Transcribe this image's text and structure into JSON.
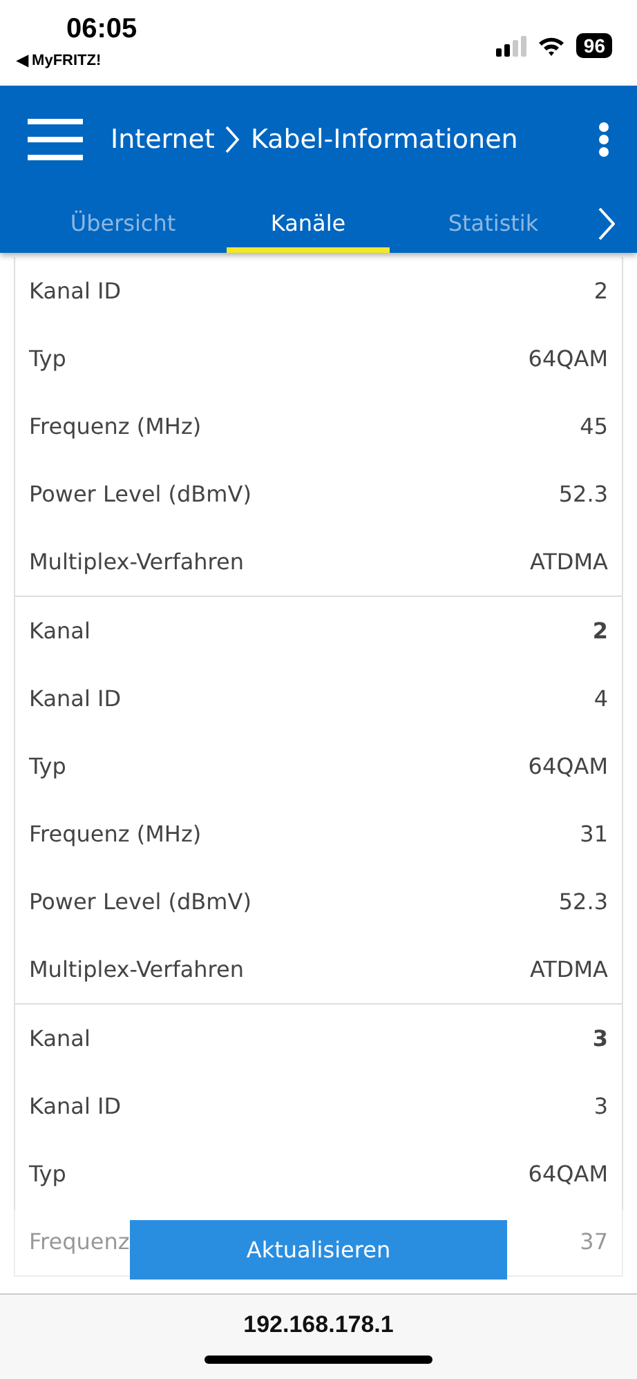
{
  "status_bar": {
    "time": "06:05",
    "back_app": "◀ MyFRITZ!",
    "battery": "96"
  },
  "header": {
    "title": "Internet",
    "subtitle": "Kabel-Informationen"
  },
  "tabs": [
    {
      "label": "Übersicht",
      "selected": false
    },
    {
      "label": "Kanäle",
      "selected": true
    },
    {
      "label": "Statistik",
      "selected": false
    }
  ],
  "groups": [
    {
      "rows": [
        {
          "kind": "field",
          "label": "Kanal ID",
          "value": "2"
        },
        {
          "kind": "field",
          "label": "Typ",
          "value": "64QAM"
        },
        {
          "kind": "field",
          "label": "Frequenz (MHz)",
          "value": "45"
        },
        {
          "kind": "field",
          "label": "Power Level (dBmV)",
          "value": "52.3"
        },
        {
          "kind": "field",
          "label": "Multiplex-Verfahren",
          "value": "ATDMA"
        }
      ]
    },
    {
      "rows": [
        {
          "kind": "header",
          "label": "Kanal",
          "value": "2"
        },
        {
          "kind": "field",
          "label": "Kanal ID",
          "value": "4"
        },
        {
          "kind": "field",
          "label": "Typ",
          "value": "64QAM"
        },
        {
          "kind": "field",
          "label": "Frequenz (MHz)",
          "value": "31"
        },
        {
          "kind": "field",
          "label": "Power Level (dBmV)",
          "value": "52.3"
        },
        {
          "kind": "field",
          "label": "Multiplex-Verfahren",
          "value": "ATDMA"
        }
      ]
    },
    {
      "rows": [
        {
          "kind": "header",
          "label": "Kanal",
          "value": "3"
        },
        {
          "kind": "field",
          "label": "Kanal ID",
          "value": "3"
        },
        {
          "kind": "field",
          "label": "Typ",
          "value": "64QAM"
        },
        {
          "kind": "field",
          "label": "Frequenz",
          "value": "37"
        }
      ]
    }
  ],
  "refresh_button": "Aktualisieren",
  "url": "192.168.178.1"
}
